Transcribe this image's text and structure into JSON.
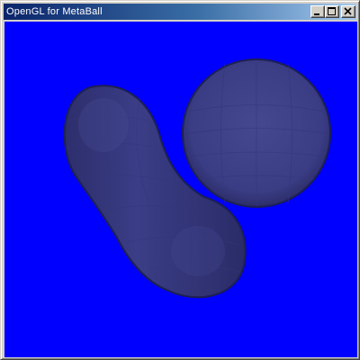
{
  "window": {
    "title": "OpenGL for MetaBall",
    "controls": {
      "minimize_icon": "minimize-icon",
      "maximize_icon": "maximize-icon",
      "close_icon": "close-icon"
    }
  },
  "viewport": {
    "background_color": "#0000ff",
    "object_color": "#3a3c86",
    "object_count": 3
  }
}
